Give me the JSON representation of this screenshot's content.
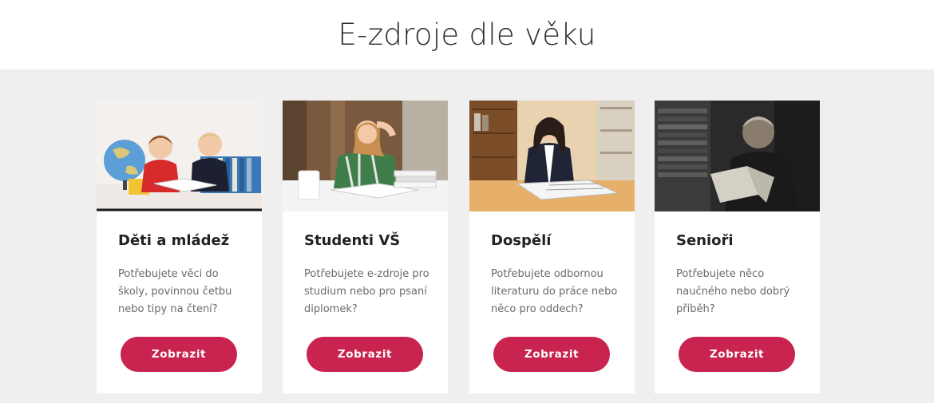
{
  "page": {
    "title": "E-zdroje dle věku"
  },
  "cards": [
    {
      "title": "Děti a mládež",
      "text": "Potřebujete věci do školy, povinnou četbu nebo tipy na čtení?",
      "button": "Zobrazit",
      "image": "children-reading-globe-photo"
    },
    {
      "title": "Studenti VŠ",
      "text": "Potřebujete e-zdroje pro studium nebo pro psaní diplomek?",
      "button": "Zobrazit",
      "image": "student-studying-photo"
    },
    {
      "title": "Dospělí",
      "text": "Potřebujete odbornou literaturu do práce nebo něco pro oddech?",
      "button": "Zobrazit",
      "image": "woman-reading-newspaper-photo"
    },
    {
      "title": "Senioři",
      "text": "Potřebujete něco naučného nebo dobrý příběh?",
      "button": "Zobrazit",
      "image": "senior-reading-book-photo"
    }
  ],
  "colors": {
    "accent": "#c8244f",
    "band": "#efefef",
    "title": "#2b2b2b",
    "body_text": "#6a6a6a"
  }
}
